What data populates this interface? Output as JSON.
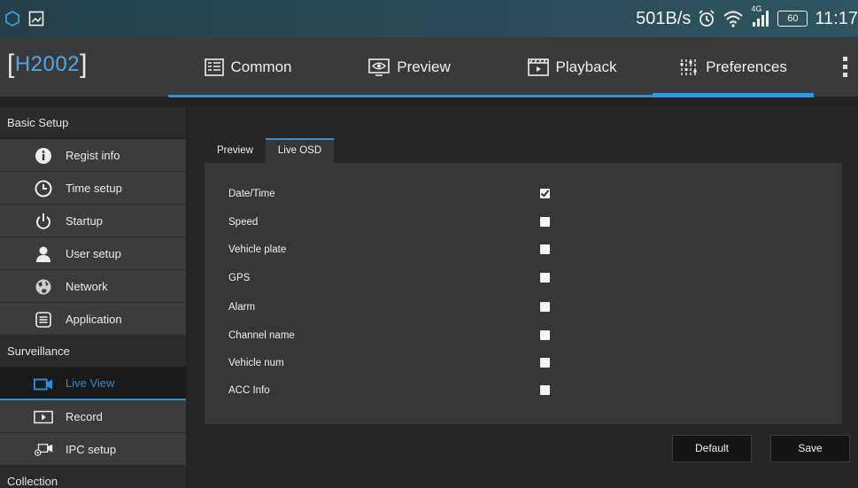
{
  "statusbar": {
    "speed": "501B/s",
    "network_badge": "4G",
    "battery": "60",
    "time": "11:17"
  },
  "brand": {
    "name": "H2002"
  },
  "tabs": [
    {
      "label": "Common",
      "icon": "grid-icon"
    },
    {
      "label": "Preview",
      "icon": "eye-icon"
    },
    {
      "label": "Playback",
      "icon": "film-icon"
    },
    {
      "label": "Preferences",
      "icon": "sliders-icon",
      "active": true
    }
  ],
  "sidebar": {
    "sections": [
      {
        "label": "Basic Setup"
      },
      {
        "label": "Surveillance"
      },
      {
        "label": "Collection"
      }
    ],
    "items": [
      {
        "label": "Regist info",
        "icon": "info-icon"
      },
      {
        "label": "Time setup",
        "icon": "clock-icon"
      },
      {
        "label": "Startup",
        "icon": "power-icon"
      },
      {
        "label": "User setup",
        "icon": "user-icon"
      },
      {
        "label": "Network",
        "icon": "globe-icon"
      },
      {
        "label": "Application",
        "icon": "document-icon"
      },
      {
        "label": "Live View",
        "icon": "camera-icon",
        "active": true
      },
      {
        "label": "Record",
        "icon": "play-icon"
      },
      {
        "label": "IPC setup",
        "icon": "ipc-camera-icon"
      }
    ]
  },
  "subtabs": [
    {
      "label": "Preview"
    },
    {
      "label": "Live OSD",
      "active": true
    }
  ],
  "osd_options": [
    {
      "label": "Date/Time",
      "checked": true
    },
    {
      "label": "Speed",
      "checked": false
    },
    {
      "label": "Vehicle plate",
      "checked": false
    },
    {
      "label": "GPS",
      "checked": false
    },
    {
      "label": "Alarm",
      "checked": false
    },
    {
      "label": "Channel name",
      "checked": false
    },
    {
      "label": "Vehicle num",
      "checked": false
    },
    {
      "label": "ACC Info",
      "checked": false
    }
  ],
  "buttons": {
    "default_label": "Default",
    "save_label": "Save"
  },
  "colors": {
    "accent": "#2a9be8",
    "status_bar": "#2c4e58"
  }
}
